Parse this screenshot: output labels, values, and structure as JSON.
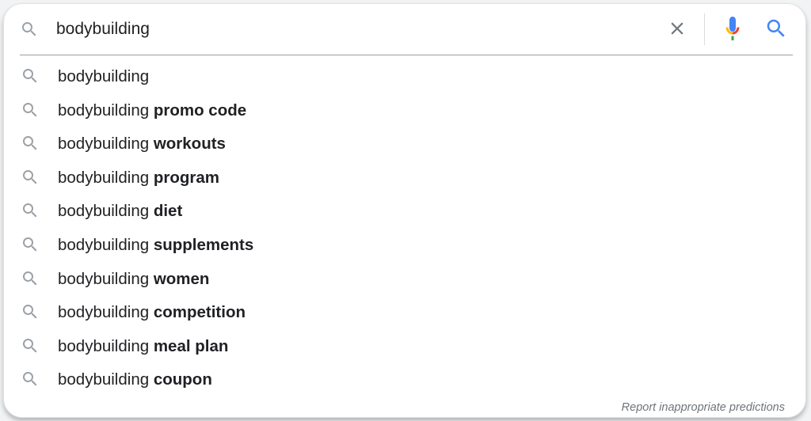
{
  "search": {
    "value": "bodybuilding",
    "placeholder": ""
  },
  "icons": {
    "leading": "search-icon",
    "clear": "close-icon",
    "voice": "microphone-icon",
    "submit": "search-icon",
    "suggestion": "search-icon"
  },
  "colors": {
    "icon_grey": "#9aa0a6",
    "clear_grey": "#70757a",
    "accent_blue": "#4285f4",
    "mic_red": "#ea4335",
    "mic_yellow": "#fbbc04",
    "mic_green": "#34a853",
    "text": "#202124",
    "report_text": "#70757a"
  },
  "suggestions": [
    {
      "prefix": "bodybuilding",
      "completion": ""
    },
    {
      "prefix": "bodybuilding ",
      "completion": "promo code"
    },
    {
      "prefix": "bodybuilding ",
      "completion": "workouts"
    },
    {
      "prefix": "bodybuilding ",
      "completion": "program"
    },
    {
      "prefix": "bodybuilding ",
      "completion": "diet"
    },
    {
      "prefix": "bodybuilding ",
      "completion": "supplements"
    },
    {
      "prefix": "bodybuilding ",
      "completion": "women"
    },
    {
      "prefix": "bodybuilding ",
      "completion": "competition"
    },
    {
      "prefix": "bodybuilding ",
      "completion": "meal plan"
    },
    {
      "prefix": "bodybuilding ",
      "completion": "coupon"
    }
  ],
  "footer": {
    "report_label": "Report inappropriate predictions"
  }
}
